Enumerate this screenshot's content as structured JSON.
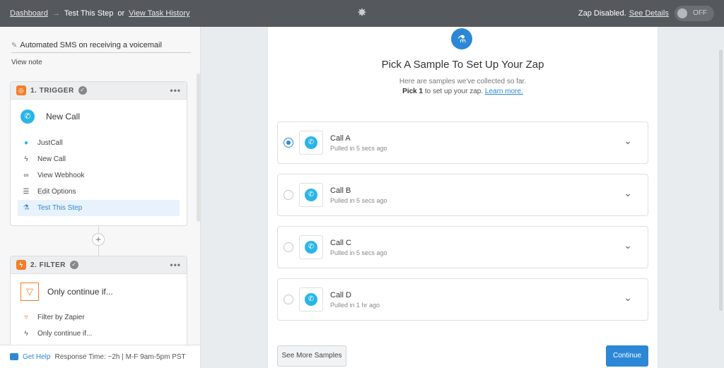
{
  "topbar": {
    "dashboard": "Dashboard",
    "arrow": "→",
    "current": "Test This Step",
    "or": "or",
    "history": "View Task History",
    "zap_status": "Zap Disabled.",
    "see_details": "See Details",
    "toggle_label": "OFF"
  },
  "sidebar": {
    "zap_name": "Automated SMS on receiving a voicemail",
    "view_note": "View note",
    "trigger": {
      "header": "1. TRIGGER",
      "title": "New Call",
      "steps": [
        {
          "label": "JustCall",
          "icon": "justcall-icon"
        },
        {
          "label": "New Call",
          "icon": "bolt-icon"
        },
        {
          "label": "View Webhook",
          "icon": "link-icon"
        },
        {
          "label": "Edit Options",
          "icon": "list-icon"
        },
        {
          "label": "Test This Step",
          "icon": "flask-icon"
        }
      ]
    },
    "filter": {
      "header": "2. FILTER",
      "title": "Only continue if...",
      "steps": [
        {
          "label": "Filter by Zapier",
          "icon": "filter-icon"
        },
        {
          "label": "Only continue if...",
          "icon": "bolt-icon"
        }
      ]
    },
    "help": {
      "label": "Get Help",
      "response": "Response Time: ~2h | M-F 9am-5pm PST"
    }
  },
  "main": {
    "title": "Pick A Sample To Set Up Your Zap",
    "sub1": "Here are samples we've collected so far.",
    "sub2_bold": "Pick 1",
    "sub2_rest": "to set up your zap.",
    "learn_more": "Learn more.",
    "samples": [
      {
        "name": "Call A",
        "time": "Pulled in 5 secs ago",
        "selected": true
      },
      {
        "name": "Call B",
        "time": "Pulled in 5 secs ago",
        "selected": false
      },
      {
        "name": "Call C",
        "time": "Pulled in 5 secs ago",
        "selected": false
      },
      {
        "name": "Call D",
        "time": "Pulled in 1 hr ago",
        "selected": false
      }
    ],
    "see_more": "See More Samples",
    "continue": "Continue"
  },
  "colors": {
    "accent": "#2c87d6",
    "topbar": "#55595e",
    "trigger_badge": "#f37d2a",
    "justcall": "#29b5e8"
  }
}
